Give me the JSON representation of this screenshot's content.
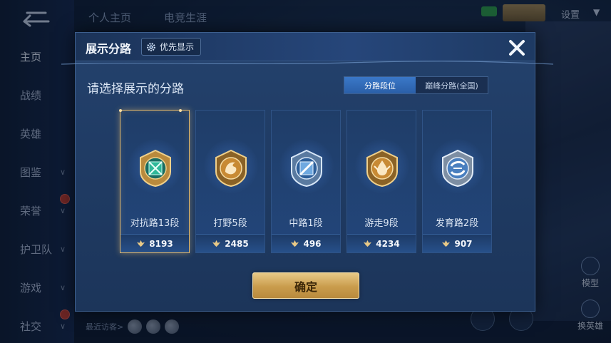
{
  "background": {
    "top_tabs": [
      "个人主页",
      "电竞生涯"
    ],
    "settings_label": "设置",
    "sidebar": [
      {
        "label": "主页",
        "active": true,
        "chevron": false,
        "badge": false
      },
      {
        "label": "战绩",
        "active": false,
        "chevron": false,
        "badge": false
      },
      {
        "label": "英雄",
        "active": false,
        "chevron": false,
        "badge": false
      },
      {
        "label": "图鉴",
        "active": false,
        "chevron": true,
        "badge": false
      },
      {
        "label": "荣誉",
        "active": false,
        "chevron": true,
        "badge": true
      },
      {
        "label": "护卫队",
        "active": false,
        "chevron": true,
        "badge": false
      },
      {
        "label": "游戏",
        "active": false,
        "chevron": true,
        "badge": false
      },
      {
        "label": "社交",
        "active": false,
        "chevron": true,
        "badge": true
      }
    ],
    "recent_visitors_label": "最近访客>",
    "model_label": "模型",
    "switch_hero_label": "换英雄"
  },
  "dialog": {
    "title": "展示分路",
    "priority_button": "优先显示",
    "instruction": "请选择展示的分路",
    "tabs": [
      {
        "label": "分路段位",
        "selected": true
      },
      {
        "label": "巅峰分路(全国)",
        "selected": false
      }
    ],
    "lanes": [
      {
        "label": "对抗路13段",
        "score": "8193",
        "selected": true,
        "icon": "clash-lane-icon",
        "color": "#2fb89a"
      },
      {
        "label": "打野5段",
        "score": "2485",
        "selected": false,
        "icon": "jungle-dragon-icon",
        "color": "#d89a3a"
      },
      {
        "label": "中路1段",
        "score": "496",
        "selected": false,
        "icon": "mid-lane-icon",
        "color": "#6fa9e0"
      },
      {
        "label": "游走9段",
        "score": "4234",
        "selected": false,
        "icon": "roam-icon",
        "color": "#d89a3a"
      },
      {
        "label": "发育路2段",
        "score": "907",
        "selected": false,
        "icon": "farm-lane-icon",
        "color": "#7fb4e8"
      }
    ],
    "confirm_button": "确定"
  },
  "colors": {
    "accent_gold": "#e3b86a",
    "tab_active": "#3a78c8",
    "dialog_bg": "#203c65"
  }
}
